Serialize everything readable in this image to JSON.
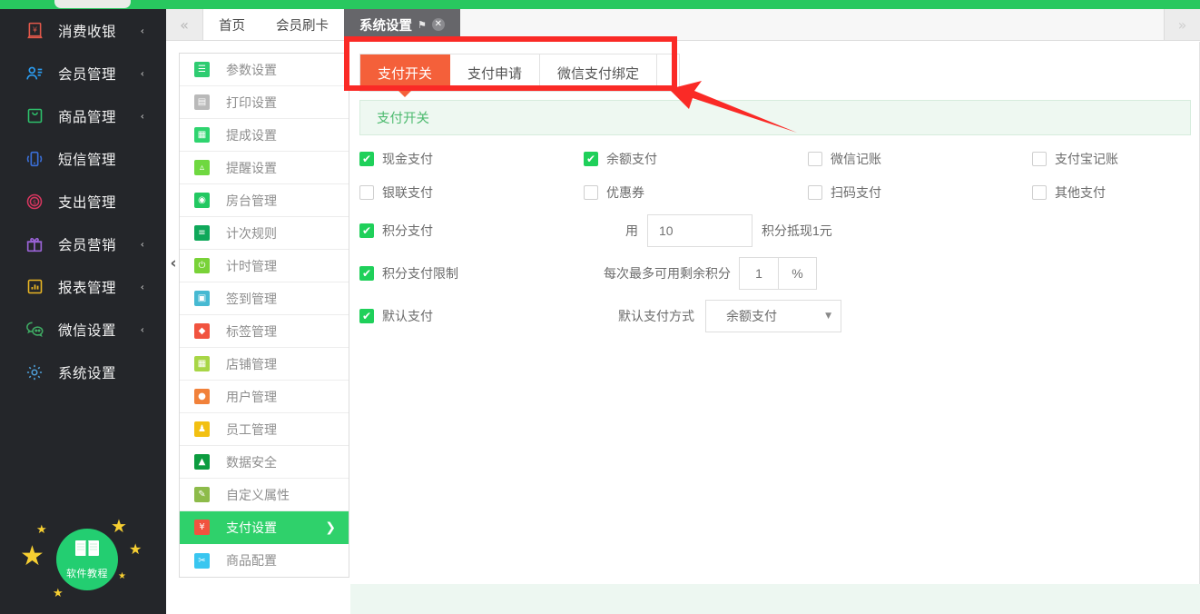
{
  "sidebar": {
    "items": [
      {
        "label": "消费收银",
        "icon": "cash-register-icon",
        "color": "#e2584a",
        "glyph": "¥",
        "has_arrow": true
      },
      {
        "label": "会员管理",
        "icon": "member-user-icon",
        "color": "#2b9cf0",
        "glyph": "☰",
        "has_arrow": true
      },
      {
        "label": "商品管理",
        "icon": "goods-bag-icon",
        "color": "#2ec16c",
        "glyph": "⌣",
        "has_arrow": true
      },
      {
        "label": "短信管理",
        "icon": "sms-phone-icon",
        "color": "#3a6fd8",
        "glyph": "▯",
        "has_arrow": false
      },
      {
        "label": "支出管理",
        "icon": "expense-coin-icon",
        "color": "#d6365f",
        "glyph": "$",
        "has_arrow": false
      },
      {
        "label": "会员营销",
        "icon": "gift-box-icon",
        "color": "#9a63d6",
        "glyph": "⚑",
        "has_arrow": true
      },
      {
        "label": "报表管理",
        "icon": "report-chart-icon",
        "color": "#e9b524",
        "glyph": "▐",
        "has_arrow": true
      },
      {
        "label": "微信设置",
        "icon": "wechat-icon",
        "color": "#3faa63",
        "glyph": "●",
        "has_arrow": true
      },
      {
        "label": "系统设置",
        "icon": "gear-icon",
        "color": "#4e9fd8",
        "glyph": "⚙",
        "has_arrow": false
      }
    ],
    "logo": {
      "label": "软件教程",
      "icon": "book-icon",
      "color": "#23ce71"
    }
  },
  "tabbar": {
    "collapse_icon": "«",
    "expand_icon": "»",
    "tabs": [
      {
        "label": "首页",
        "active": false,
        "closable": false
      },
      {
        "label": "会员刷卡",
        "active": false,
        "closable": false
      },
      {
        "label": "系统设置",
        "active": true,
        "closable": true
      }
    ],
    "pin_icon": "⚑",
    "close_icon": "✕"
  },
  "submenu": {
    "items": [
      {
        "label": "参数设置",
        "icon": "params-icon",
        "color": "#2ecc71",
        "active": false
      },
      {
        "label": "打印设置",
        "icon": "printer-icon",
        "color": "#b9b9b9",
        "active": false
      },
      {
        "label": "提成设置",
        "icon": "commission-icon",
        "color": "#2fd46f",
        "active": false
      },
      {
        "label": "提醒设置",
        "icon": "bell-icon",
        "color": "#6fd840",
        "active": false
      },
      {
        "label": "房台管理",
        "icon": "room-icon",
        "color": "#22c861",
        "active": false
      },
      {
        "label": "计次规则",
        "icon": "count-rule-icon",
        "color": "#0fa85a",
        "active": false
      },
      {
        "label": "计时管理",
        "icon": "timer-clock-icon",
        "color": "#79d238",
        "active": false
      },
      {
        "label": "签到管理",
        "icon": "calendar-check-icon",
        "color": "#46b9d2",
        "active": false
      },
      {
        "label": "标签管理",
        "icon": "tag-icon",
        "color": "#f1533f",
        "active": false
      },
      {
        "label": "店铺管理",
        "icon": "shop-icon",
        "color": "#a8d646",
        "active": false
      },
      {
        "label": "用户管理",
        "icon": "user-icon",
        "color": "#f1813a",
        "active": false
      },
      {
        "label": "员工管理",
        "icon": "staff-icon",
        "color": "#f2c012",
        "active": false
      },
      {
        "label": "数据安全",
        "icon": "data-security-icon",
        "color": "#0c9c3f",
        "active": false
      },
      {
        "label": "自定义属性",
        "icon": "custom-attr-icon",
        "color": "#8dbb4a",
        "active": false
      },
      {
        "label": "支付设置",
        "icon": "payment-icon",
        "color": "#f1533f",
        "active": true
      },
      {
        "label": "商品配置",
        "icon": "goods-config-icon",
        "color": "#39c6f0",
        "active": false
      }
    ],
    "active_chevron": "❯",
    "pane_handle_icon": "‹"
  },
  "content": {
    "tabs": [
      {
        "label": "支付开关",
        "active": true
      },
      {
        "label": "支付申请",
        "active": false
      },
      {
        "label": "微信支付绑定",
        "active": false
      }
    ],
    "panel_title": "支付开关",
    "rows": [
      {
        "cells": [
          {
            "label": "现金支付",
            "checked": true
          },
          {
            "label": "余额支付",
            "checked": true
          },
          {
            "label": "微信记账",
            "checked": false
          },
          {
            "label": "支付宝记账",
            "checked": false
          }
        ]
      },
      {
        "cells": [
          {
            "label": "银联支付",
            "checked": false
          },
          {
            "label": "优惠券",
            "checked": false
          },
          {
            "label": "扫码支付",
            "checked": false
          },
          {
            "label": "其他支付",
            "checked": false
          }
        ]
      }
    ],
    "points_pay": {
      "label": "积分支付",
      "checked": true,
      "prefix": "用",
      "value": "10",
      "suffix": "积分抵现1元"
    },
    "points_limit": {
      "label": "积分支付限制",
      "checked": true,
      "prefix": "每次最多可用剩余积分",
      "value": "1",
      "unit": "%"
    },
    "default_pay": {
      "label": "默认支付",
      "checked": true,
      "prefix": "默认支付方式",
      "selected": "余额支付",
      "caret": "▼"
    }
  },
  "colors": {
    "brand_green": "#28c85f",
    "accent_orange": "#f4603a",
    "annotation_red": "#fa2a26",
    "sidebar_dark": "#24262a",
    "active_green": "#2fd16b"
  }
}
